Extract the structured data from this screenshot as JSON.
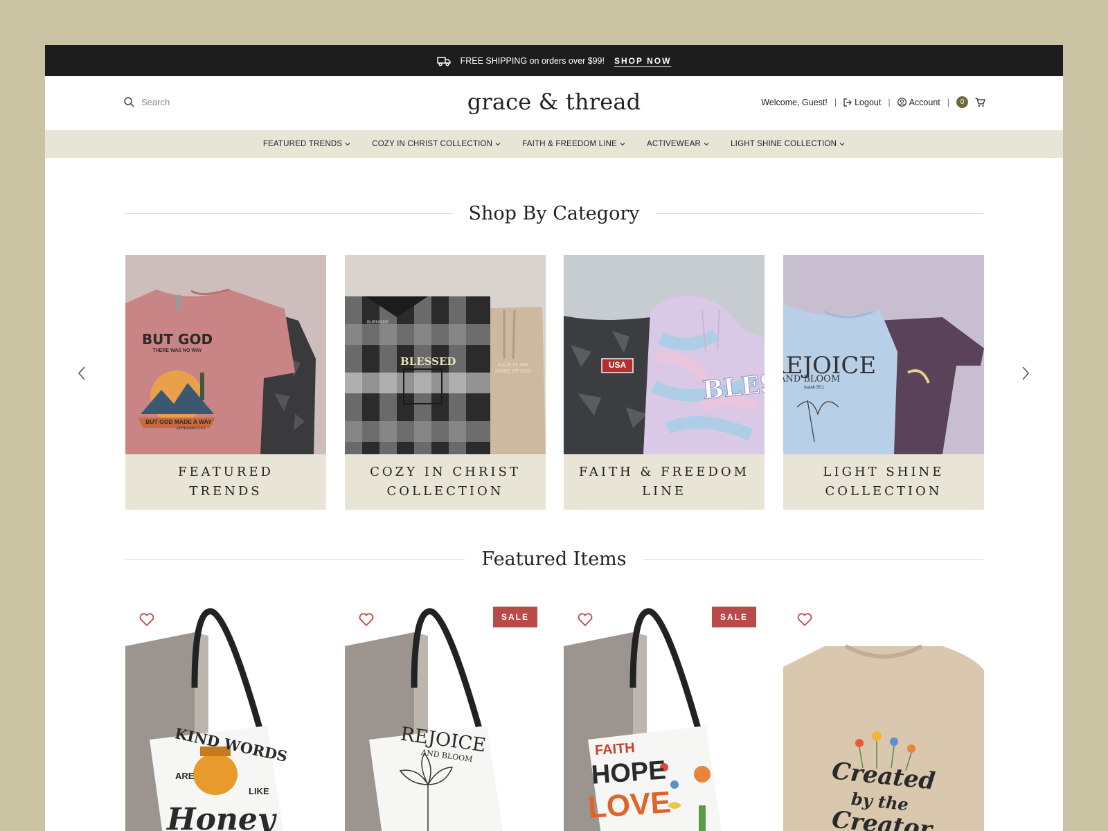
{
  "promo": {
    "text": "FREE SHIPPING on orders over $99!",
    "cta": "SHOP NOW"
  },
  "header": {
    "search_placeholder": "Search",
    "brand": "grace & thread",
    "welcome": "Welcome, Guest!",
    "logout": "Logout",
    "account": "Account",
    "cart_count": "0",
    "separator": "|"
  },
  "nav": {
    "items": [
      {
        "label": "FEATURED TRENDS"
      },
      {
        "label": "COZY IN CHRIST COLLECTION"
      },
      {
        "label": "FAITH & FREEDOM LINE"
      },
      {
        "label": "ACTIVEWEAR"
      },
      {
        "label": "LIGHT SHINE COLLECTION"
      }
    ]
  },
  "categories": {
    "title": "Shop By Category",
    "items": [
      {
        "label": "FEATURED TRENDS",
        "shirt_text": "BUT GOD",
        "shirt_sub": "THERE WAS NO WAY",
        "shirt_foot": "BUT GOD MADE A WAY",
        "shirt_ref": "EPHESIANS 2:4-5"
      },
      {
        "label": "COZY IN CHRIST COLLECTION",
        "shirt_text": "BLESSED",
        "pants_text": "MADE IN THE IMAGE OF GOD",
        "tag": "BURNSIDE"
      },
      {
        "label": "FAITH & FREEDOM LINE",
        "shirt_text": "USA",
        "hoodie_text": "BLESSED"
      },
      {
        "label": "LIGHT SHINE COLLECTION",
        "shirt_text": "REJOICE",
        "shirt_sub": "AND BLOOM",
        "shirt_ref": "Isaiah 35:1"
      }
    ]
  },
  "featured": {
    "title": "Featured Items",
    "sale_label": "SALE",
    "items": [
      {
        "sale": false,
        "art_line1": "KIND WORDS",
        "art_line2": "ARE",
        "art_line3": "LIKE",
        "art_line4": "Honey"
      },
      {
        "sale": true,
        "art_line1": "REJOICE",
        "art_line2": "AND BLOOM"
      },
      {
        "sale": true,
        "art_line1": "FAITH",
        "art_line2": "HOPE",
        "art_line3": "LOVE"
      },
      {
        "sale": false,
        "art_line1": "Created",
        "art_line2": "by the",
        "art_line3": "Creator"
      }
    ]
  },
  "colors": {
    "accent": "#6f6a3c",
    "sale": "#b94a48",
    "nav_bg": "#e8e5d6",
    "page_bg": "#c9c3a3"
  }
}
